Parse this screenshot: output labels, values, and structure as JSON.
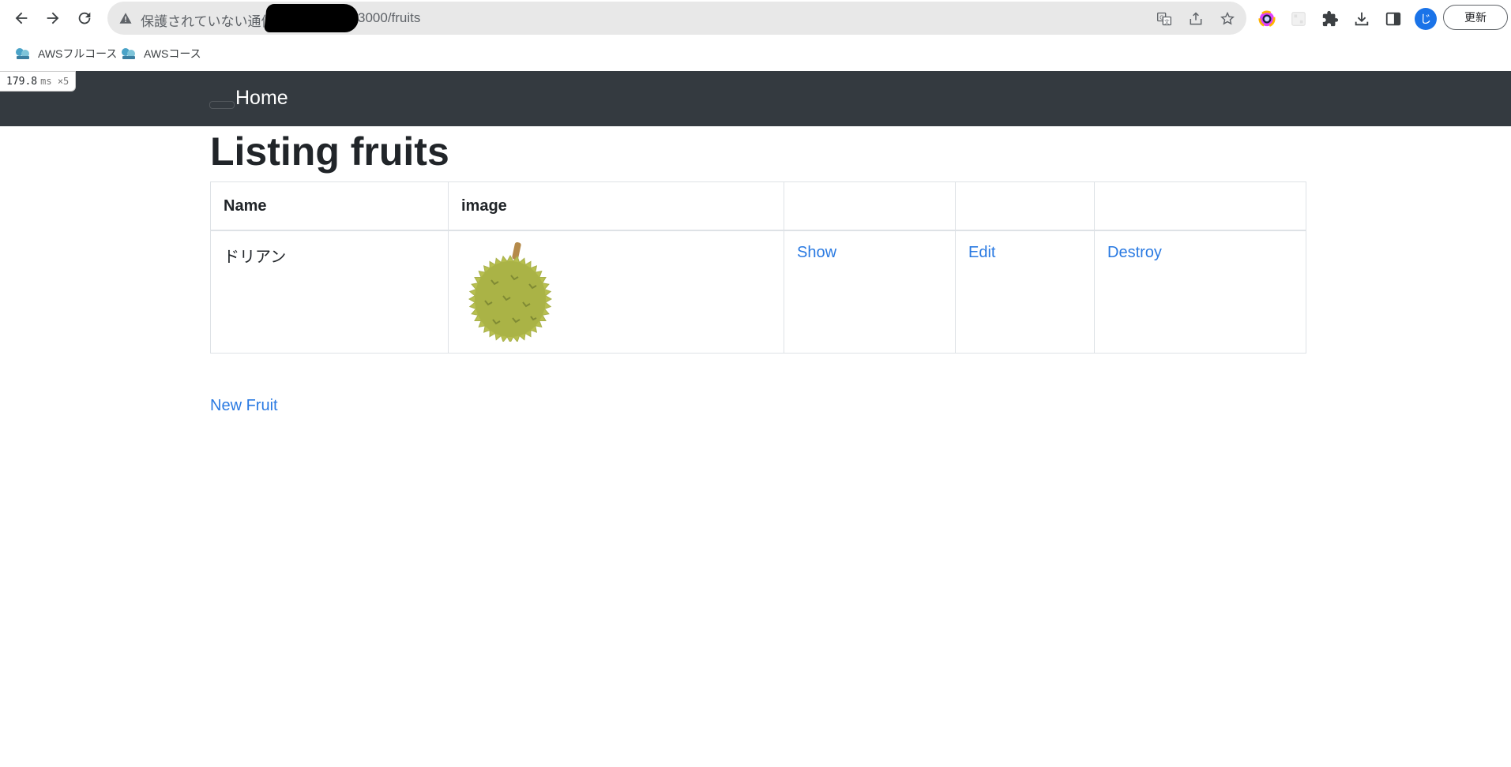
{
  "browser": {
    "security_label": "保護されていない通信",
    "url_suffix": "3000/fruits",
    "update_label": "更新",
    "avatar_letter": "じ",
    "bookmarks": [
      {
        "label": "AWSフルコース"
      },
      {
        "label": "AWSコース"
      }
    ],
    "icons": [
      "back-icon",
      "forward-icon",
      "reload-icon",
      "warning-icon",
      "translate-icon",
      "share-icon",
      "star-icon",
      "color-picker-extension-icon",
      "extension-icon",
      "puzzle-icon",
      "download-icon",
      "side-panel-icon"
    ]
  },
  "timing": {
    "value": "179.8",
    "unit": "ms ×5"
  },
  "navbar": {
    "home_label": "Home"
  },
  "page": {
    "title": "Listing fruits",
    "new_link": "New Fruit"
  },
  "table": {
    "headers": [
      "Name",
      "image",
      "",
      "",
      ""
    ],
    "rows": [
      {
        "name": "ドリアン",
        "image": "durian",
        "show": "Show",
        "edit": "Edit",
        "destroy": "Destroy"
      }
    ]
  },
  "colors": {
    "navbar": "#343a40",
    "link": "#2a7ae2",
    "text": "#212529"
  }
}
